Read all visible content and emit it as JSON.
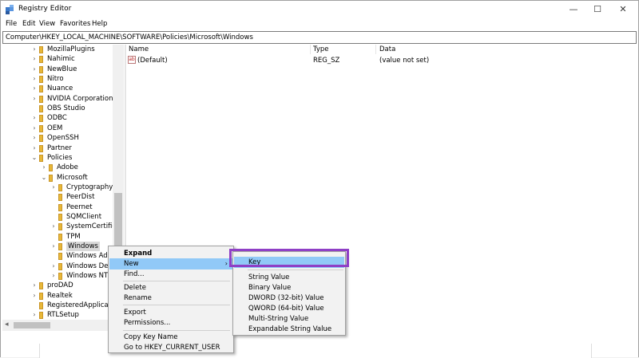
{
  "window": {
    "title": "Registry Editor",
    "minimize_glyph": "—",
    "maximize_glyph": "☐",
    "close_glyph": "✕"
  },
  "menubar": {
    "items": [
      "File",
      "Edit",
      "View",
      "Favorites",
      "Help"
    ]
  },
  "address": {
    "path": "Computer\\HKEY_LOCAL_MACHINE\\SOFTWARE\\Policies\\Microsoft\\Windows"
  },
  "tree": {
    "items": [
      {
        "label": "MozillaPlugins",
        "chev": "›"
      },
      {
        "label": "Nahimic",
        "chev": "›"
      },
      {
        "label": "NewBlue",
        "chev": "›"
      },
      {
        "label": "Nitro",
        "chev": "›"
      },
      {
        "label": "Nuance",
        "chev": "›"
      },
      {
        "label": "NVIDIA Corporation",
        "chev": "›"
      },
      {
        "label": "OBS Studio",
        "chev": ""
      },
      {
        "label": "ODBC",
        "chev": "›"
      },
      {
        "label": "OEM",
        "chev": "›"
      },
      {
        "label": "OpenSSH",
        "chev": "›"
      },
      {
        "label": "Partner",
        "chev": "›"
      },
      {
        "label": "Policies",
        "chev": "⌄"
      },
      {
        "label": "Adobe",
        "chev": "›"
      },
      {
        "label": "Microsoft",
        "chev": "⌄"
      },
      {
        "label": "Cryptography",
        "chev": "›"
      },
      {
        "label": "PeerDist",
        "chev": ""
      },
      {
        "label": "Peernet",
        "chev": ""
      },
      {
        "label": "SQMClient",
        "chev": ""
      },
      {
        "label": "SystemCertificates",
        "chev": "›"
      },
      {
        "label": "TPM",
        "chev": ""
      },
      {
        "label": "Windows",
        "chev": "›"
      },
      {
        "label": "Windows Advanced Threat Protection",
        "chev": ""
      },
      {
        "label": "Windows Defender",
        "chev": "›"
      },
      {
        "label": "Windows NT",
        "chev": "›"
      },
      {
        "label": "proDAD",
        "chev": "›"
      },
      {
        "label": "Realtek",
        "chev": "›"
      },
      {
        "label": "RegisteredApplications",
        "chev": ""
      },
      {
        "label": "RTLSetup",
        "chev": "›"
      }
    ]
  },
  "list": {
    "headers": {
      "name": "Name",
      "type": "Type",
      "data": "Data"
    },
    "rows": [
      {
        "icon": "ab",
        "name": "(Default)",
        "type": "REG_SZ",
        "data": "(value not set)"
      }
    ]
  },
  "context_menu": {
    "items": [
      {
        "label": "Expand",
        "bold": true
      },
      {
        "label": "New",
        "arrow": "›",
        "highlighted": true
      },
      {
        "label": "Find..."
      },
      {
        "label": "Delete"
      },
      {
        "label": "Rename"
      },
      {
        "label": "Export"
      },
      {
        "label": "Permissions..."
      },
      {
        "label": "Copy Key Name"
      },
      {
        "label": "Go to HKEY_CURRENT_USER"
      }
    ]
  },
  "submenu": {
    "items": [
      {
        "label": "Key",
        "highlighted": true
      },
      {
        "label": "String Value"
      },
      {
        "label": "Binary Value"
      },
      {
        "label": "DWORD (32-bit) Value"
      },
      {
        "label": "QWORD (64-bit) Value"
      },
      {
        "label": "Multi-String Value"
      },
      {
        "label": "Expandable String Value"
      }
    ]
  },
  "colors": {
    "highlight": "#91c9f7",
    "annotation_box": "#8f3fc6",
    "folder": "#e8b838"
  }
}
